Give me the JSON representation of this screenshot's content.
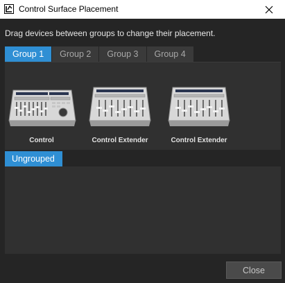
{
  "window": {
    "title": "Control Surface Placement",
    "close_icon": "close-icon"
  },
  "instruction": "Drag devices between groups to change their placement.",
  "tabs": [
    {
      "label": "Group 1",
      "active": true
    },
    {
      "label": "Group 2",
      "active": false
    },
    {
      "label": "Group 3",
      "active": false
    },
    {
      "label": "Group 4",
      "active": false
    }
  ],
  "devices": [
    {
      "label": "Control",
      "icon": "control-surface-icon"
    },
    {
      "label": "Control Extender",
      "icon": "control-extender-icon"
    },
    {
      "label": "Control Extender",
      "icon": "control-extender-icon"
    }
  ],
  "ungrouped": {
    "label": "Ungrouped"
  },
  "buttons": {
    "close_label": "Close"
  },
  "colors": {
    "accent": "#2f8fd4",
    "background": "#252525",
    "panel": "#303030"
  }
}
